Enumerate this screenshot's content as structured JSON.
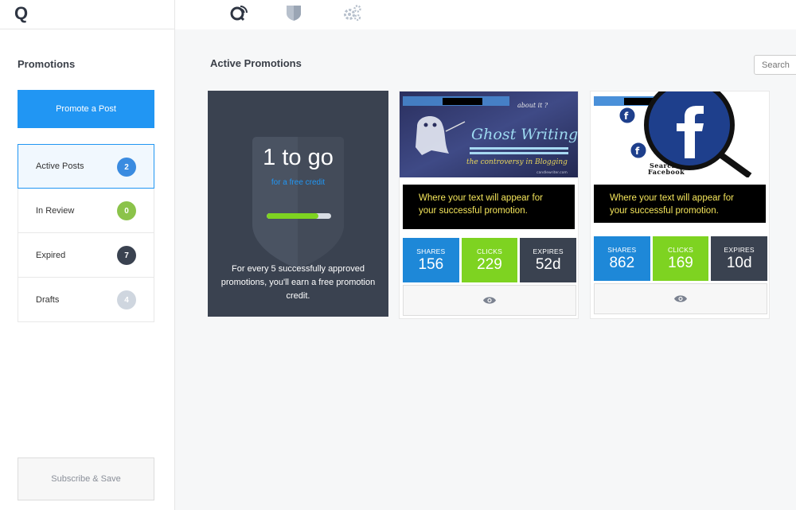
{
  "brand": {
    "logo": "Q"
  },
  "nav": {
    "icons": [
      "feed-icon",
      "shield-icon",
      "gears-icon"
    ]
  },
  "sidebar": {
    "title": "Promotions",
    "promote_label": "Promote a Post",
    "items": [
      {
        "label": "Active Posts",
        "count": "2",
        "color": "#3a8be0"
      },
      {
        "label": "In Review",
        "count": "0",
        "color": "#8bc34a"
      },
      {
        "label": "Expired",
        "count": "7",
        "color": "#3a4250"
      },
      {
        "label": "Drafts",
        "count": "4",
        "color": "#cfd6df"
      }
    ],
    "subscribe_label": "Subscribe & Save"
  },
  "main": {
    "title": "Active Promotions",
    "search_placeholder": "Search"
  },
  "credit": {
    "count_text": "1 to go",
    "sub_text": "for a free credit",
    "progress_fraction": 0.8,
    "description": "For every 5 successfully approved promotions, you'll earn a free promotion credit."
  },
  "posts": [
    {
      "image": {
        "headline": "Ghost Writing",
        "tag": "about it ?",
        "subtitle": "the controversy in Blogging",
        "credit": "candlewriter.com"
      },
      "text": "Where your text will appear for your successful promotion.",
      "stats": [
        {
          "key": "SHARES",
          "value": "156",
          "color": "#1e88d8"
        },
        {
          "key": "CLICKS",
          "value": "229",
          "color": "#7ed321"
        },
        {
          "key": "EXPIRES",
          "value": "52d",
          "color": "#3a4250"
        }
      ]
    },
    {
      "image": {
        "caption": "Search Facebook"
      },
      "text": "Where your text will appear for your successful promotion.",
      "stats": [
        {
          "key": "SHARES",
          "value": "862",
          "color": "#1e88d8"
        },
        {
          "key": "CLICKS",
          "value": "169",
          "color": "#7ed321"
        },
        {
          "key": "EXPIRES",
          "value": "10d",
          "color": "#3a4250"
        }
      ]
    }
  ]
}
